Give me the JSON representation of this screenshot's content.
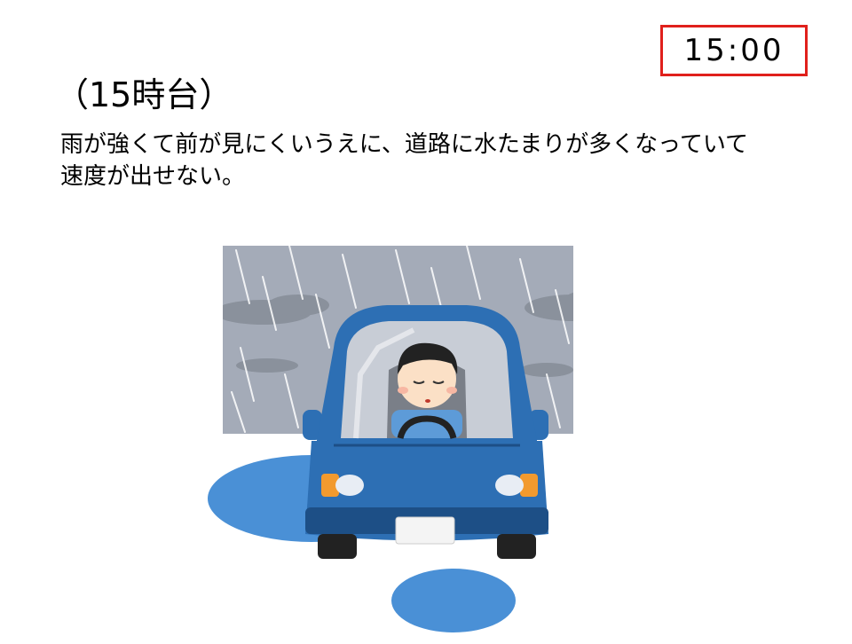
{
  "time_label": "15:00",
  "heading": "（15時台）",
  "description": "雨が強くて前が見にくいうえに、道路に水たまりが多くなっていて速度が出せない。",
  "illustration": {
    "icon": "car-in-rain-icon",
    "colors": {
      "sky": "#a4abb8",
      "cloud": "#8a919c",
      "car_body": "#2d6fb4",
      "car_dark": "#1d4f86",
      "puddle": "#4a90d6",
      "headlight": "#f29a2e",
      "skin": "#fbe0c6",
      "hair": "#222222"
    }
  },
  "colors": {
    "time_border": "#e0201c"
  }
}
